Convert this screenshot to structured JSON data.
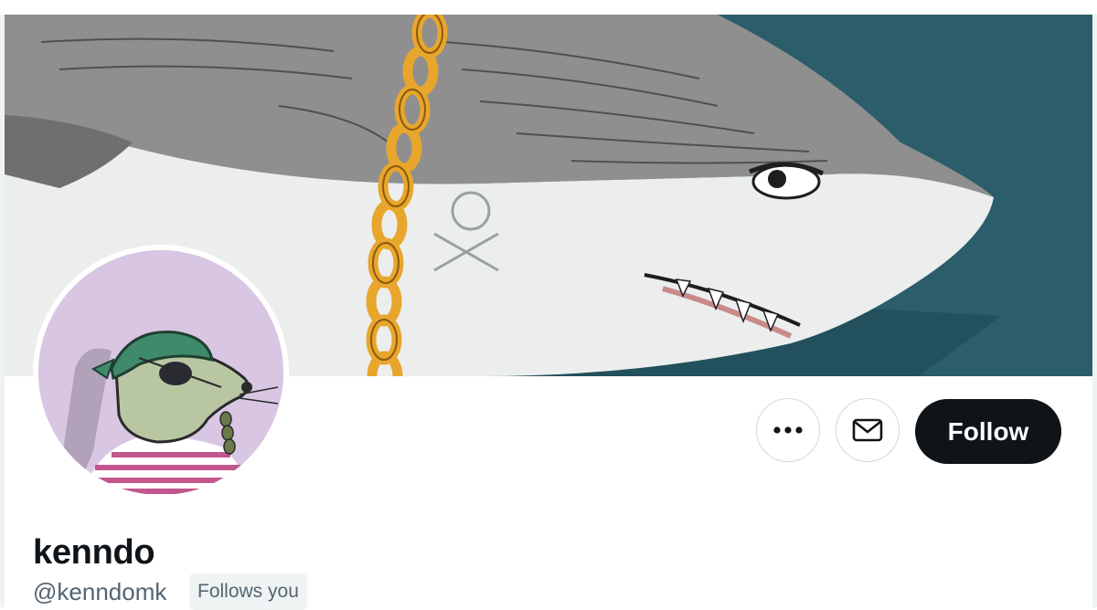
{
  "profile": {
    "display_name": "kenndo",
    "handle": "@kenndomk",
    "follows_you_label": "Follows you"
  },
  "actions": {
    "more_icon": "more-horizontal-icon",
    "message_icon": "envelope-icon",
    "follow_label": "Follow"
  },
  "colors": {
    "banner_background": "#2b5d6b",
    "follow_button": "#0f1419",
    "avatar_background": "#d8c6e2",
    "chain_gold": "#e8a62c",
    "secondary_text": "#536471"
  }
}
